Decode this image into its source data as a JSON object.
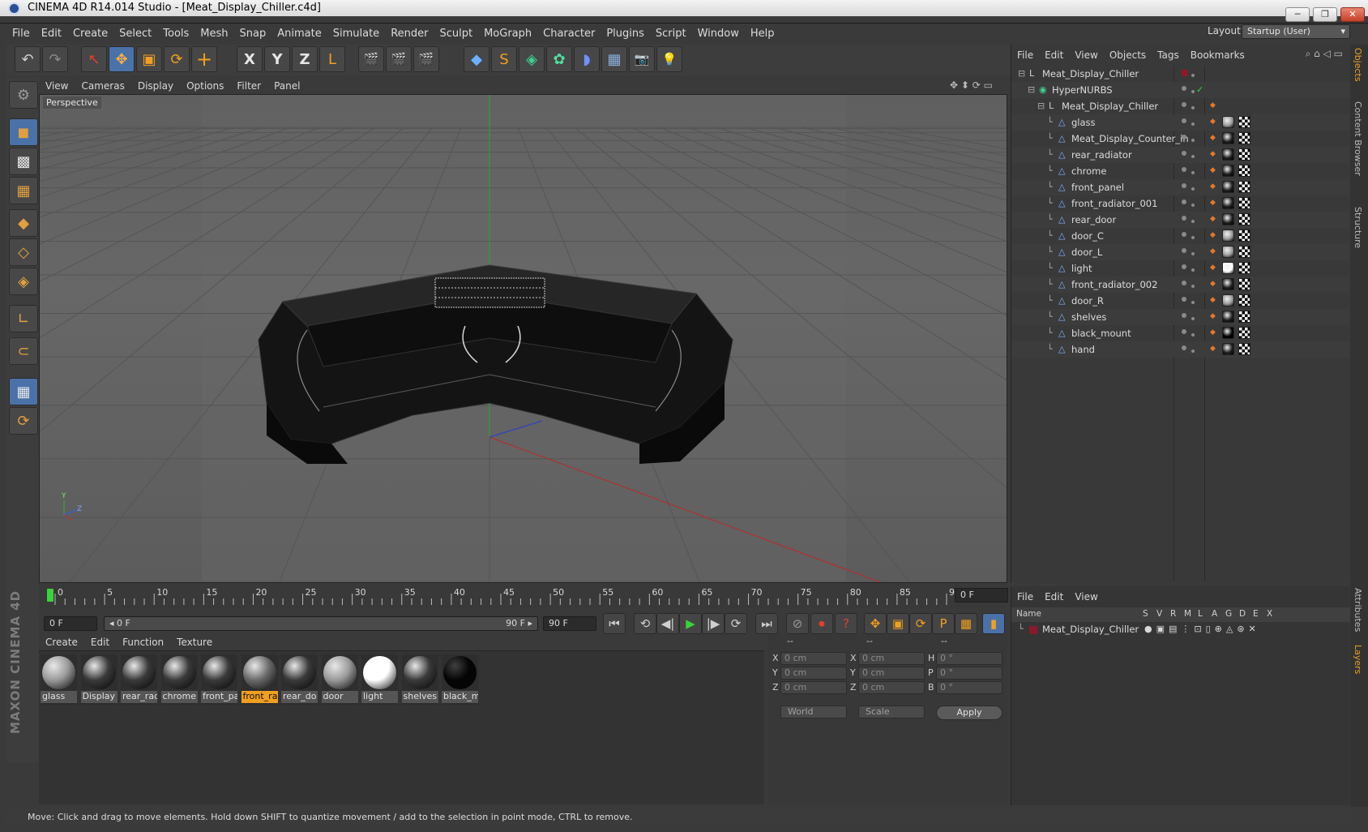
{
  "window": {
    "title": "CINEMA 4D R14.014 Studio - [Meat_Display_Chiller.c4d]",
    "min": "─",
    "restore": "❐",
    "close": "✕"
  },
  "menubar": [
    "File",
    "Edit",
    "Create",
    "Select",
    "Tools",
    "Mesh",
    "Snap",
    "Animate",
    "Simulate",
    "Render",
    "Sculpt",
    "MoGraph",
    "Character",
    "Plugins",
    "Script",
    "Window",
    "Help"
  ],
  "layout": {
    "label": "Layout:",
    "value": "Startup (User)"
  },
  "toolbar": {
    "undo_icon": "↶",
    "redo_icon": "↷",
    "select_icon": "↖",
    "move_icon": "✥",
    "scale_icon": "▣",
    "rotate_icon": "⟳",
    "add_icon": "+",
    "x_axis": "X",
    "y_axis": "Y",
    "z_axis": "Z",
    "coord_icon": "L",
    "render_icon": "🎬",
    "cube_icon": "◆",
    "spline_icon": "S",
    "nurbs_icon": "◈",
    "array_icon": "✿",
    "deformer_icon": "◗",
    "floor_icon": "▦",
    "camera_icon": "📷",
    "light_icon": "💡"
  },
  "left_toolbar": [
    "model",
    "texture",
    "workplane",
    "points",
    "edges",
    "polygons",
    "axis",
    "magnet",
    "snap",
    "lock"
  ],
  "viewport": {
    "menu": [
      "View",
      "Cameras",
      "Display",
      "Options",
      "Filter",
      "Panel"
    ],
    "label": "Perspective",
    "axis_y": "Y",
    "axis_z": "Z",
    "nav_icons": "✥ ⬍ ⟳ ▭"
  },
  "timeline": {
    "ticks": [
      "0",
      "5",
      "10",
      "15",
      "20",
      "25",
      "30",
      "35",
      "40",
      "45",
      "50",
      "55",
      "60",
      "65",
      "70",
      "75",
      "80",
      "85",
      "90"
    ],
    "current_frame": "0 F"
  },
  "transport": {
    "start_field": "0 F",
    "range_start": "◂ 0 F",
    "range_end": "90 F ▸",
    "end_field": "90 F",
    "first": "⏮",
    "prev_key": "⟲",
    "prev": "◀|",
    "play": "▶",
    "next": "|▶",
    "next_key": "⟳",
    "last": "⏭"
  },
  "materials": {
    "menu": [
      "Create",
      "Edit",
      "Function",
      "Texture"
    ],
    "items": [
      {
        "label": "glass",
        "color": "#9a9a9a"
      },
      {
        "label": "Display",
        "color": "#3a3a3a"
      },
      {
        "label": "rear_rad",
        "color": "#3a3a3a"
      },
      {
        "label": "chrome",
        "color": "#3a3a3a"
      },
      {
        "label": "front_pa",
        "color": "#3a3a3a"
      },
      {
        "label": "front_ra",
        "color": "#6a6a6a"
      },
      {
        "label": "rear_do",
        "color": "#3a3a3a"
      },
      {
        "label": "door",
        "color": "#9a9a9a"
      },
      {
        "label": "light",
        "color": "#ffffff"
      },
      {
        "label": "shelves",
        "color": "#3a3a3a"
      },
      {
        "label": "black_m",
        "color": "#050505"
      }
    ],
    "selected_index": 5
  },
  "coords": {
    "headers": [
      "--",
      "--",
      "--"
    ],
    "rows": [
      {
        "a": "X",
        "av": "0 cm",
        "b": "X",
        "bv": "0 cm",
        "c": "H",
        "cv": "0 °"
      },
      {
        "a": "Y",
        "av": "0 cm",
        "b": "Y",
        "bv": "0 cm",
        "c": "P",
        "cv": "0 °"
      },
      {
        "a": "Z",
        "av": "0 cm",
        "b": "Z",
        "bv": "0 cm",
        "c": "B",
        "cv": "0 °"
      }
    ],
    "mode1": "World",
    "mode2": "Scale",
    "apply": "Apply"
  },
  "object_manager": {
    "menu": [
      "File",
      "Edit",
      "View",
      "Objects",
      "Tags",
      "Bookmarks"
    ],
    "items": [
      {
        "name": "Meat_Display_Chiller",
        "indent": 0,
        "type": "null"
      },
      {
        "name": "HyperNURBS",
        "indent": 1,
        "type": "nurbs"
      },
      {
        "name": "Meat_Display_Chiller",
        "indent": 2,
        "type": "null"
      },
      {
        "name": "glass",
        "indent": 3,
        "type": "poly",
        "mat": "#9c9c9c"
      },
      {
        "name": "Meat_Display_Counter_in",
        "indent": 3,
        "type": "poly",
        "mat": "#202020"
      },
      {
        "name": "rear_radiator",
        "indent": 3,
        "type": "poly",
        "mat": "#202020"
      },
      {
        "name": "chrome",
        "indent": 3,
        "type": "poly",
        "mat": "#202020"
      },
      {
        "name": "front_panel",
        "indent": 3,
        "type": "poly",
        "mat": "#202020"
      },
      {
        "name": "front_radiator_001",
        "indent": 3,
        "type": "poly",
        "mat": "#202020"
      },
      {
        "name": "rear_door",
        "indent": 3,
        "type": "poly",
        "mat": "#202020"
      },
      {
        "name": "door_C",
        "indent": 3,
        "type": "poly",
        "mat": "#9c9c9c"
      },
      {
        "name": "door_L",
        "indent": 3,
        "type": "poly",
        "mat": "#9c9c9c"
      },
      {
        "name": "light",
        "indent": 3,
        "type": "poly",
        "mat": "#ffffff"
      },
      {
        "name": "front_radiator_002",
        "indent": 3,
        "type": "poly",
        "mat": "#202020"
      },
      {
        "name": "door_R",
        "indent": 3,
        "type": "poly",
        "mat": "#9c9c9c"
      },
      {
        "name": "shelves",
        "indent": 3,
        "type": "poly",
        "mat": "#202020"
      },
      {
        "name": "black_mount",
        "indent": 3,
        "type": "poly",
        "mat": "#000000"
      },
      {
        "name": "hand",
        "indent": 3,
        "type": "poly",
        "mat": "#202020"
      }
    ]
  },
  "layers": {
    "menu": [
      "File",
      "Edit",
      "View"
    ],
    "columns": [
      "Name",
      "S",
      "V",
      "R",
      "M",
      "L",
      "A",
      "G",
      "D",
      "E",
      "X"
    ],
    "rows": [
      {
        "name": "Meat_Display_Chiller",
        "color": "#8a1a2a"
      }
    ]
  },
  "side_tabs": [
    "Objects",
    "Content Browser",
    "Structure",
    "Attributes",
    "Layers"
  ],
  "status": "Move: Click and drag to move elements. Hold down SHIFT to quantize movement / add to the selection in point mode, CTRL to remove.",
  "branding": "MAXON CINEMA 4D",
  "colors": {
    "accent": "#f0a020",
    "selection_blue": "#4a72a8",
    "x_axis": "#c03030",
    "y_axis": "#30b030",
    "z_axis": "#3040c0"
  }
}
